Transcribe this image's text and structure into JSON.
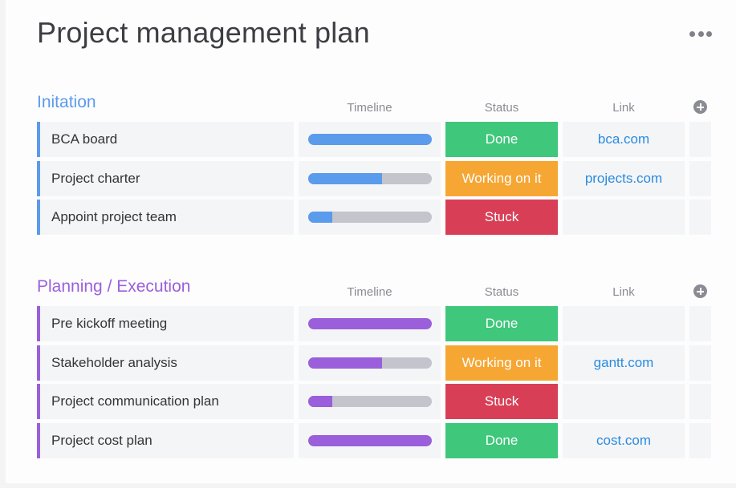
{
  "page": {
    "title": "Project management plan",
    "more_icon": "more-horizontal-icon"
  },
  "columns": {
    "timeline": "Timeline",
    "status": "Status",
    "link": "Link",
    "add_column_icon": "plus-circle-icon"
  },
  "status_colors": {
    "Done": "#3fc77b",
    "Working on it": "#f6a633",
    "Stuck": "#d83f56"
  },
  "groups": [
    {
      "title": "Initation",
      "color": "#5b9bec",
      "items": [
        {
          "name": "BCA board",
          "timeline_progress": 1.0,
          "status": "Done",
          "link": "bca.com"
        },
        {
          "name": "Project charter",
          "timeline_progress": 0.6,
          "status": "Working on it",
          "link": "projects.com"
        },
        {
          "name": "Appoint project team",
          "timeline_progress": 0.2,
          "status": "Stuck",
          "link": ""
        }
      ]
    },
    {
      "title": "Planning / Execution",
      "color": "#9b5fdb",
      "items": [
        {
          "name": "Pre kickoff meeting",
          "timeline_progress": 1.0,
          "status": "Done",
          "link": ""
        },
        {
          "name": "Stakeholder analysis",
          "timeline_progress": 0.6,
          "status": "Working on it",
          "link": "gantt.com"
        },
        {
          "name": "Project communication plan",
          "timeline_progress": 0.2,
          "status": "Stuck",
          "link": ""
        },
        {
          "name": "Project cost plan",
          "timeline_progress": 1.0,
          "status": "Done",
          "link": "cost.com"
        }
      ]
    }
  ]
}
